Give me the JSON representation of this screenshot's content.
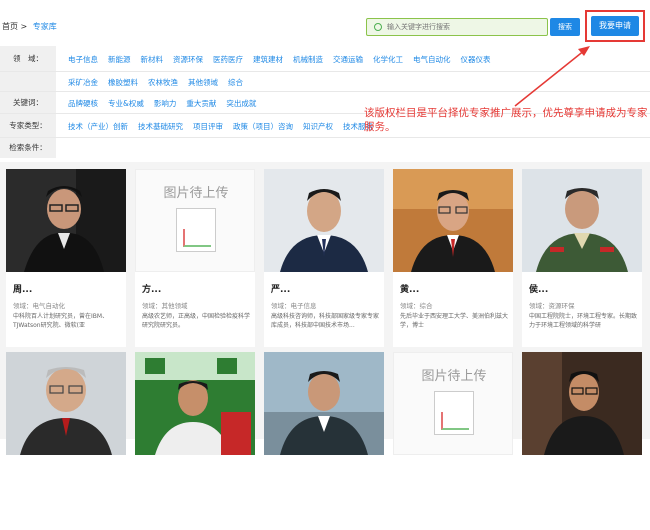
{
  "header": {
    "home": "首页",
    "sep": ">",
    "current": "专家库",
    "search_placeholder": "输入关键字进行搜索",
    "search_btn": "搜索",
    "apply_btn": "我要申请"
  },
  "filters": [
    {
      "label": "领　域：",
      "items": [
        "电子信息",
        "新能源",
        "新材料",
        "资源环保",
        "医药医疗",
        "建筑建材",
        "机械制造",
        "交通运输",
        "化学化工",
        "电气自动化",
        "仪器仪表"
      ]
    },
    {
      "label": "",
      "items": [
        "采矿冶金",
        "橡胶塑料",
        "农林牧渔",
        "其他领域",
        "综合"
      ]
    },
    {
      "label": "关键词：",
      "items": [
        "品牌硬核",
        "专业&权威",
        "影响力",
        "重大贡献",
        "突出成就"
      ]
    },
    {
      "label": "专家类型：",
      "items": [
        "技术（产业）创新",
        "技术基础研究",
        "项目评审",
        "政策（项目）咨询",
        "知识产权",
        "技术服务"
      ]
    },
    {
      "label": "检索条件：",
      "items": []
    }
  ],
  "annotation": "该版权栏目是平台择优专家推广展示，优先尊享申请成为专家服务。",
  "placeholder_text": "图片待上传",
  "experts": [
    {
      "name": "周...",
      "field": "领域：电气自动化",
      "desc": "中科院百人计划研究员，曾在IBM、TJWatson研究院、微软(亚"
    },
    {
      "name": "方...",
      "field": "领域：其他领域",
      "desc": "高级农艺师，正高级，中国检验检疫科学研究院研究员。"
    },
    {
      "name": "严...",
      "field": "领域：电子信息",
      "desc": "高级科技咨询师，科技部国家级专家专家库成员，科技部中国技术市场..."
    },
    {
      "name": "黄...",
      "field": "领域：综合",
      "desc": "先后毕业于西安理工大学、美洲伯利兹大学，博士"
    },
    {
      "name": "侯...",
      "field": "领域：资源环保",
      "desc": "中国工程院院士，环境工程专家。长期致力于环境工程领域的科学研"
    }
  ],
  "colors": {
    "accent": "#1e88e5",
    "highlight": "#e53935",
    "search_bg": "#eef7e6"
  }
}
